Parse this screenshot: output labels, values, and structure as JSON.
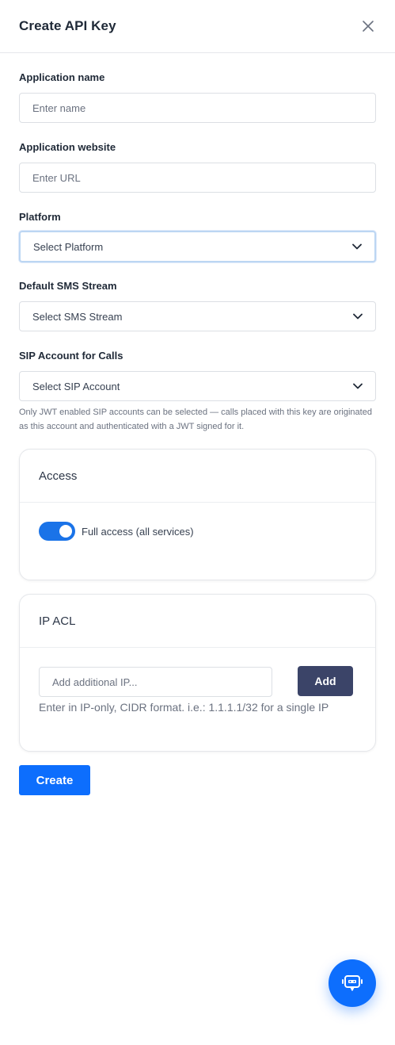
{
  "header": {
    "title": "Create API Key"
  },
  "form": {
    "app_name": {
      "label": "Application name",
      "placeholder": "Enter name"
    },
    "app_website": {
      "label": "Application website",
      "placeholder": "Enter URL"
    },
    "platform": {
      "label": "Platform",
      "value": "Select Platform"
    },
    "sms_stream": {
      "label": "Default SMS Stream",
      "value": "Select SMS Stream"
    },
    "sip_account": {
      "label": "SIP Account for Calls",
      "value": "Select SIP Account",
      "help_line1": "Only JWT enabled SIP accounts can be selected — calls placed with this key are originated",
      "help_line2": "as this account and authenticated with a JWT signed for it."
    }
  },
  "access_card": {
    "title": "Access",
    "toggle_label": "Full access (all services)",
    "toggle_on": true
  },
  "ip_acl_card": {
    "title": "IP ACL",
    "input_placeholder": "Add additional IP...",
    "add_label": "Add",
    "help": "Enter in IP-only, CIDR format. i.e.: 1.1.1.1/32 for a single IP"
  },
  "actions": {
    "create_label": "Create"
  },
  "colors": {
    "primary": "#0d6efd",
    "dark_button": "#3b4468",
    "toggle": "#1a73e8"
  },
  "icons": {
    "close": "close-icon",
    "chevron": "chevron-down-icon",
    "chat": "chat-bot-icon"
  }
}
